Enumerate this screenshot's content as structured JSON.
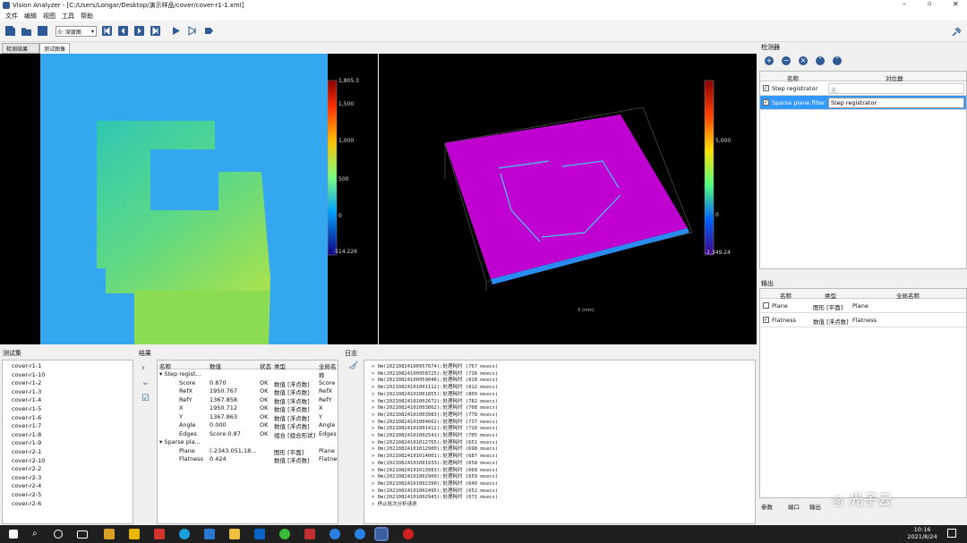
{
  "window": {
    "title": "Vision Analyzer - [C:/Users/Longar/Desktop/演示样品/cover/cover-r1-1.xml]"
  },
  "menu": [
    "文件",
    "编辑",
    "视图",
    "工具",
    "帮助"
  ],
  "toolbar": {
    "view_select": "0: 深度图"
  },
  "tabs": [
    "检测结果",
    "测试图像"
  ],
  "left_view": {
    "colorbar_ticks": [
      "1,805.3",
      "1,500",
      "1,000",
      "500",
      "0",
      "-514.226"
    ]
  },
  "right_view": {
    "colorbar_ticks": [
      "",
      "5,000",
      "",
      "0",
      "-2,349.24"
    ],
    "axis_x": "X (mm)"
  },
  "detectors": {
    "title": "检测器",
    "headers": [
      "名称",
      "对位器"
    ],
    "rows": [
      {
        "checked": true,
        "name": "Step registrator",
        "registrator": "无"
      },
      {
        "checked": true,
        "name": "Sparse plane filter",
        "registrator": "Step registrator"
      }
    ]
  },
  "outputs": {
    "title": "输出",
    "headers": [
      "名称",
      "类型",
      "全局名称"
    ],
    "rows": [
      {
        "checked": false,
        "name": "Plane",
        "type": "图形 [平面]",
        "global": "Plane"
      },
      {
        "checked": true,
        "name": "Flatness",
        "type": "数值 [浮点数]",
        "global": "Flatness"
      }
    ],
    "bottom_tabs": [
      "参数",
      "端口",
      "输出"
    ]
  },
  "testset": {
    "title": "测试集",
    "items": [
      "cover-r1-1",
      "cover-r1-10",
      "cover-r1-2",
      "cover-r1-3",
      "cover-r1-4",
      "cover-r1-5",
      "cover-r1-6",
      "cover-r1-7",
      "cover-r1-8",
      "cover-r1-9",
      "cover-r2-1",
      "cover-r2-10",
      "cover-r2-2",
      "cover-r2-3",
      "cover-r2-4",
      "cover-r2-5",
      "cover-r2-6"
    ]
  },
  "results": {
    "title": "结果",
    "headers": [
      "名称",
      "数值",
      "状态",
      "类型",
      "全局名称"
    ],
    "groups": [
      {
        "name": "Step regist...",
        "rows": [
          {
            "name": "Score",
            "value": "0.870",
            "status": "OK",
            "type": "数值 [浮点数]",
            "global": "Score"
          },
          {
            "name": "RefX",
            "value": "1950.767",
            "status": "OK",
            "type": "数值 [浮点数]",
            "global": "RefX"
          },
          {
            "name": "RefY",
            "value": "1367.858",
            "status": "OK",
            "type": "数值 [浮点数]",
            "global": "RefY"
          },
          {
            "name": "X",
            "value": "1950.712",
            "status": "OK",
            "type": "数值 [浮点数]",
            "global": "X"
          },
          {
            "name": "Y",
            "value": "1367.863",
            "status": "OK",
            "type": "数值 [浮点数]",
            "global": "Y"
          },
          {
            "name": "Angle",
            "value": "0.000",
            "status": "OK",
            "type": "数值 [浮点数]",
            "global": "Angle"
          },
          {
            "name": "Edges",
            "value": "Score:0.87",
            "status": "OK",
            "type": "组合 [组合形状]",
            "global": "Edges"
          }
        ]
      },
      {
        "name": "Sparse pla...",
        "rows": [
          {
            "name": "Plane",
            "value": "(-2343.051,18...",
            "status": "",
            "type": "图形 [平面]",
            "global": "Plane"
          },
          {
            "name": "Flatness",
            "value": "0.424",
            "status": "",
            "type": "数值 [浮点数]",
            "global": "Flatnes"
          }
        ]
      }
    ]
  },
  "log": {
    "title": "日志",
    "lines": [
      "> 0m(20210824100957674):处理耗时 (767 msecs)",
      "> 0m(20210824100958725):处理耗时 (716 msecs)",
      "> 0m(20210824100959046):处理耗时 (818 msecs)",
      "> 0m(20210824101001112):处理耗时 (812 msecs)",
      "> 0m(20210824101001855):处理耗时 (809 msecs)",
      "> 0m(20210824101002672):处理耗时 (782 msecs)",
      "> 0m(20210824101003862):处理耗时 (708 msecs)",
      "> 0m(20210824101003983):处理耗时 (778 msecs)",
      "> 0m(20210824101004662):处理耗时 (737 msecs)",
      "> 0m(20210824101001412):处理耗时 (710 msecs)",
      "> 0m(20210824101002541):处理耗时 (705 msecs)",
      "> 0m(20210824101012765):处理耗时 (651 msecs)",
      "> 0m(20210824101012900):处理耗时 (698 msecs)",
      "> 0m(20210824101014001):处理耗时 (687 msecs)",
      "> 0m(20210824101001933):处理耗时 (658 msecs)",
      "> 0m(20210824101013983):处理耗时 (668 msecs)",
      "> 0m(20210824101002900):处理耗时 (659 msecs)",
      "> 0m(20210824101002390):处理耗时 (640 msecs)",
      "> 0m(20210824101002495):处理耗时 (652 msecs)",
      "> 0m(20210824101002943):处理耗时 (671 msecs)",
      "> 停止批次分析请求"
    ]
  },
  "taskbar": {
    "time": "10:16",
    "date": "2021/8/24"
  },
  "watermark": "光子云"
}
